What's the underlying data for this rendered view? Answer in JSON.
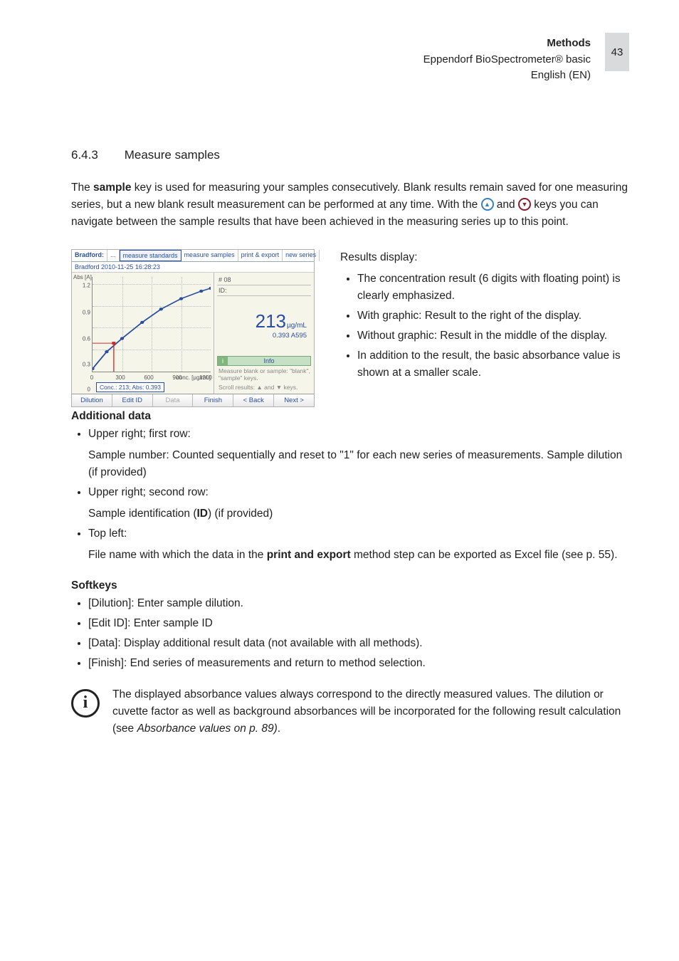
{
  "header": {
    "title": "Methods",
    "product": "Eppendorf BioSpectrometer® basic",
    "lang": "English (EN)",
    "page": "43"
  },
  "section": {
    "num": "6.4.3",
    "title": "Measure samples"
  },
  "intro": {
    "p1a": "The ",
    "p1b": "sample",
    "p1c": " key is used for measuring your samples consecutively. Blank results remain saved for one measuring series, but a new blank result measurement can be performed at any time. With the ",
    "p1d": " and ",
    "p1e": " keys you can navigate between the sample results that have been achieved in the measuring series up to this point."
  },
  "results": {
    "head": "Results display:",
    "items": [
      "The concentration result (6 digits with floating point) is clearly emphasized.",
      "With graphic: Result to the right of the display.",
      "Without graphic: Result in the middle of the display.",
      "In addition to the result, the basic absorbance value is shown at a smaller scale."
    ]
  },
  "device": {
    "tabs": {
      "lead": "Bradford:",
      "t0": "...",
      "t1": "measure standards",
      "t2": "measure samples",
      "t3": "print & export",
      "t4": "new series"
    },
    "datetime": "Bradford 2010-11-25 16:28:23",
    "sample_no": "# 08",
    "id_label": "ID:",
    "result_value": "213",
    "result_unit": "µg/mL",
    "abs_line": "0.393 A595",
    "info_label": "Info",
    "hint1": "Measure blank or sample: \"blank\", \"sample\" keys.",
    "hint2": "Scroll results: ▲ and ▼ keys.",
    "conc_box": "Conc.: 213; Abs: 0.393",
    "softkeys": {
      "dilution": "Dilution",
      "editid": "Edit ID",
      "data": "Data",
      "finish": "Finish",
      "back": "< Back",
      "next": "Next >"
    }
  },
  "chart_data": {
    "type": "line",
    "title": "",
    "xlabel": "conc. [µg/mL]",
    "ylabel": "Abs [A]",
    "xlim": [
      0,
      1200
    ],
    "ylim": [
      0,
      1.3
    ],
    "xticks": [
      0,
      300,
      600,
      900,
      1200
    ],
    "yticks": [
      0.0,
      0.3,
      0.6,
      0.9,
      1.2
    ],
    "series": [
      {
        "name": "standards",
        "x": [
          0,
          150,
          300,
          500,
          700,
          900,
          1100,
          1200
        ],
        "y": [
          0.04,
          0.28,
          0.46,
          0.68,
          0.86,
          1.0,
          1.1,
          1.14
        ]
      }
    ],
    "marker": {
      "x": 213,
      "y": 0.393
    }
  },
  "additional": {
    "head": "Additional data",
    "row1_head": "Upper right; first row:",
    "row1_body": "Sample number: Counted sequentially and reset to \"1\" for each new series of measurements. Sample dilution (if provided)",
    "row2_head": "Upper right; second row:",
    "row2_body_a": "Sample identification (",
    "row2_body_b": "ID",
    "row2_body_c": ") (if provided)",
    "row3_head": "Top left:",
    "row3_body_a": "File name with which the data in the ",
    "row3_body_b": "print and export",
    "row3_body_c": " method step can be exported as Excel file (see p. 55)."
  },
  "softkeys": {
    "head": "Softkeys",
    "items": [
      "[Dilution]: Enter sample dilution.",
      "[Edit ID]: Enter sample ID",
      "[Data]: Display additional result data (not available with all methods).",
      "[Finish]: End series of measurements and return to method selection."
    ]
  },
  "note": {
    "text_a": "The displayed absorbance values always correspond to the directly measured values. The dilution or cuvette factor as well as background absorbances will be incorporated for the following result calculation (see ",
    "text_b": "Absorbance values on p. 89)",
    "text_c": "."
  }
}
